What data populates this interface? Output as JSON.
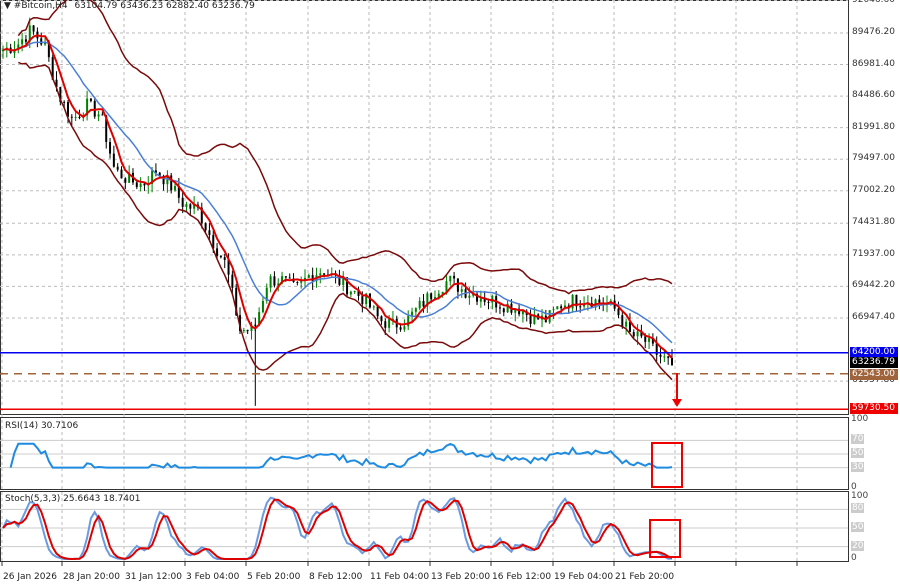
{
  "header": {
    "symbol": "#Bitcoin,H4",
    "ohlc": "63104.79 63436.23 62882.40 63236.79"
  },
  "price_axis": [
    "92046.60",
    "89476.20",
    "86981.40",
    "84486.60",
    "81991.80",
    "79497.00",
    "77002.20",
    "74431.80",
    "71937.00",
    "69442.20",
    "66947.40",
    "61957.80"
  ],
  "tags": [
    {
      "text": "64200.00",
      "value": 64200,
      "color": "#0000ee"
    },
    {
      "text": "63236.79",
      "value": 63236.79,
      "color": "#000000"
    },
    {
      "text": "62543.00",
      "value": 62543,
      "color": "#a0643c"
    },
    {
      "text": "59730.50",
      "value": 59730.5,
      "color": "#ee0000"
    }
  ],
  "time_axis": [
    "26 Jan 2026",
    "28 Jan 20:00",
    "31 Jan 12:00",
    "3 Feb 04:00",
    "5 Feb 20:00",
    "8 Feb 12:00",
    "11 Feb 04:00",
    "13 Feb 20:00",
    "16 Feb 12:00",
    "19 Feb 04:00",
    "21 Feb 20:00"
  ],
  "rsi": {
    "title": "RSI(14) 30.7106",
    "levels": [
      "100",
      "70",
      "50",
      "30",
      "0"
    ]
  },
  "stoch": {
    "title": "Stoch(5,3,3) 25.6643 18.7401",
    "levels": [
      "100",
      "80",
      "50",
      "20",
      "0"
    ]
  },
  "colors": {
    "bull": "#008000",
    "bear": "#000000",
    "ma_fast": "#dd0000",
    "ma_slow": "#4a7fd8",
    "bands": "#7a0a0a",
    "rsi": "#1e8be0",
    "stoch_main": "#6a9ae0",
    "stoch_signal": "#dd0000"
  },
  "chart_data": {
    "type": "line",
    "title": "#Bitcoin,H4",
    "ylim": [
      59463,
      92046.6
    ],
    "closes": [
      88132,
      88527,
      89713,
      88527,
      84575,
      82599,
      83784,
      82994,
      78646,
      77856,
      77461,
      78646,
      77461,
      75880,
      75484,
      73113,
      71137,
      65998,
      65998,
      69951,
      69951,
      69160,
      70346,
      70741,
      69951,
      69160,
      68370,
      66789,
      66394,
      66789,
      67975,
      69160,
      69951,
      69160,
      68765,
      68370,
      67975,
      67738,
      66947,
      66789,
      67975,
      68370,
      68370,
      68212,
      67580,
      65604,
      65208,
      64022,
      63237
    ],
    "hlines": [
      {
        "value": 64200,
        "color": "#0000ee",
        "style": "solid"
      },
      {
        "value": 62543,
        "color": "#a0643c",
        "style": "dashed"
      },
      {
        "value": 59730.5,
        "color": "#ee0000",
        "style": "solid"
      }
    ]
  }
}
